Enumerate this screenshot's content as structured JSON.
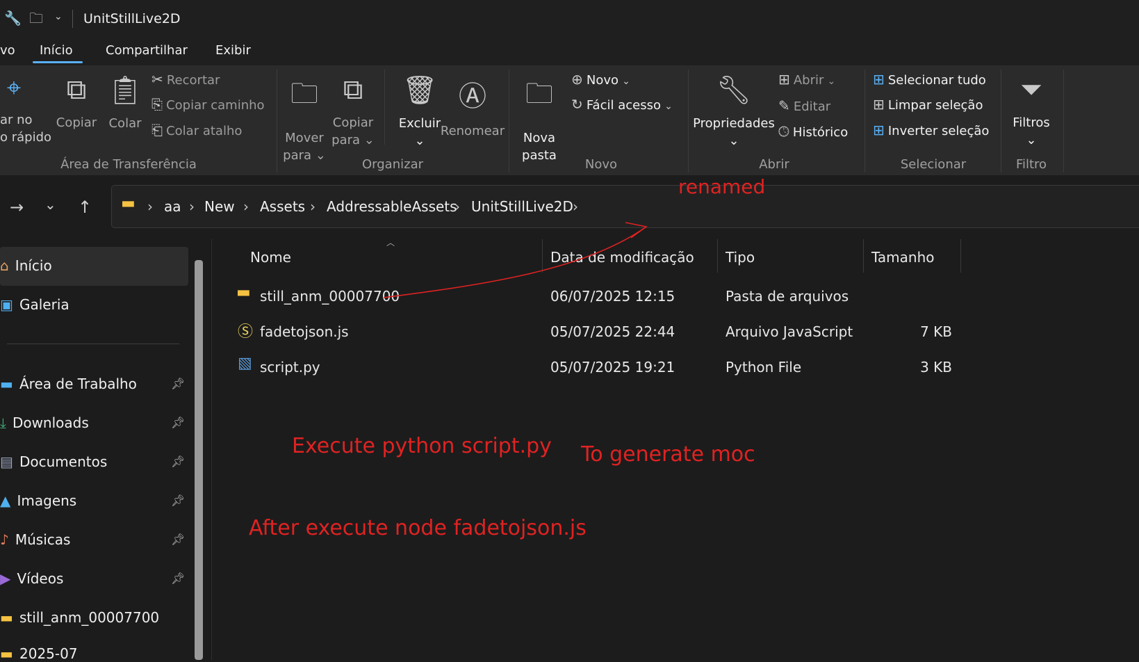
{
  "window": {
    "title": "UnitStillLive2D"
  },
  "menu": {
    "partial_first": "vo",
    "tabs": [
      "Início",
      "Compartilhar",
      "Exibir"
    ]
  },
  "ribbon": {
    "clipboard": {
      "pin_line1": "ar no",
      "pin_line2": "o rápido",
      "copy": "Copiar",
      "paste": "Colar",
      "cut": "Recortar",
      "copy_path": "Copiar caminho",
      "paste_shortcut": "Colar atalho",
      "group": "Área de Transferência"
    },
    "organize": {
      "move_line1": "Mover",
      "move_line2": "para",
      "copyto_line1": "Copiar",
      "copyto_line2": "para",
      "delete": "Excluir",
      "rename": "Renomear",
      "group": "Organizar"
    },
    "new": {
      "new_folder_line1": "Nova",
      "new_folder_line2": "pasta",
      "new_item": "Novo",
      "easy_access": "Fácil acesso",
      "group": "Novo"
    },
    "open": {
      "properties": "Propriedades",
      "open": "Abrir",
      "edit": "Editar",
      "history": "Histórico",
      "group": "Abrir"
    },
    "select": {
      "select_all": "Selecionar tudo",
      "clear_selection": "Limpar seleção",
      "invert_selection": "Inverter seleção",
      "group": "Selecionar"
    },
    "filter": {
      "filters": "Filtros",
      "group": "Filtro"
    }
  },
  "breadcrumb": [
    "aa",
    "New",
    "Assets",
    "AddressableAssets",
    "UnitStillLive2D"
  ],
  "sidebar": {
    "top_items": [
      {
        "label": "Início",
        "icon": "home-icon"
      },
      {
        "label": "Galeria",
        "icon": "gallery-icon"
      }
    ],
    "pinned_items": [
      {
        "label": "Área de Trabalho",
        "icon": "desktop-icon"
      },
      {
        "label": "Downloads",
        "icon": "download-icon"
      },
      {
        "label": "Documentos",
        "icon": "documents-icon"
      },
      {
        "label": "Imagens",
        "icon": "pictures-icon"
      },
      {
        "label": "Músicas",
        "icon": "music-icon"
      },
      {
        "label": "Vídeos",
        "icon": "videos-icon"
      }
    ],
    "folders": [
      {
        "label": "still_anm_00007700",
        "icon": "folder-icon"
      },
      {
        "label": "2025-07",
        "icon": "folder-icon"
      }
    ]
  },
  "file_list": {
    "columns": [
      "Nome",
      "Data de modificação",
      "Tipo",
      "Tamanho"
    ],
    "rows": [
      {
        "name": "still_anm_00007700",
        "date": "06/07/2025 12:15",
        "type": "Pasta de arquivos",
        "size": "",
        "icon": "folder-icon"
      },
      {
        "name": "fadetojson.js",
        "date": "05/07/2025 22:44",
        "type": "Arquivo JavaScript",
        "size": "7 KB",
        "icon": "js-file-icon"
      },
      {
        "name": "script.py",
        "date": "05/07/2025 19:21",
        "type": "Python File",
        "size": "3 KB",
        "icon": "python-file-icon"
      }
    ]
  },
  "annotations": {
    "renamed": "renamed",
    "execute_python": "Execute  python script.py",
    "generate_moc": "To generate moc",
    "execute_node": "After execute node fadetojson.js"
  },
  "colors": {
    "accent": "#5ab0f5",
    "annotation": "#e02222",
    "folder": "#f5c242"
  }
}
